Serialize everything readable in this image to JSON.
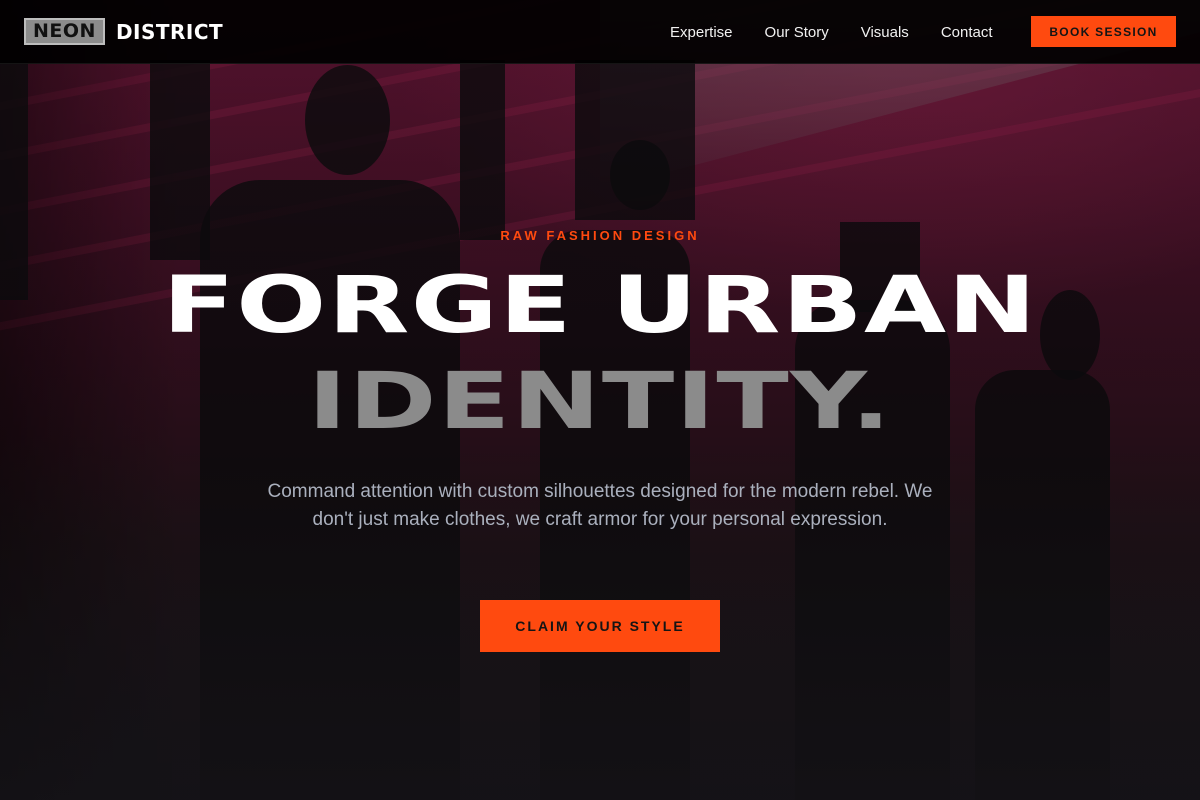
{
  "brand": {
    "logo_part1": "NEON",
    "logo_part2": "DISTRICT"
  },
  "nav": {
    "links": [
      {
        "label": "Expertise"
      },
      {
        "label": "Our Story"
      },
      {
        "label": "Visuals"
      },
      {
        "label": "Contact"
      }
    ],
    "cta_label": "BOOK SESSION"
  },
  "hero": {
    "eyebrow": "RAW FASHION DESIGN",
    "headline_line1": "FORGE URBAN",
    "headline_line2": "IDENTITY.",
    "description": "Command attention with custom silhouettes designed for the modern rebel. We don't just make clothes, we craft armor for your personal expression.",
    "cta_label": "CLAIM YOUR STYLE",
    "background": "mannequins in dark garments against a magenta-red wall"
  },
  "colors": {
    "accent": "#ff4a0f",
    "nav_bg": "#000000",
    "headline_primary": "#ffffff",
    "headline_secondary": "#8b8b8b",
    "body_text": "#aab0bd"
  }
}
